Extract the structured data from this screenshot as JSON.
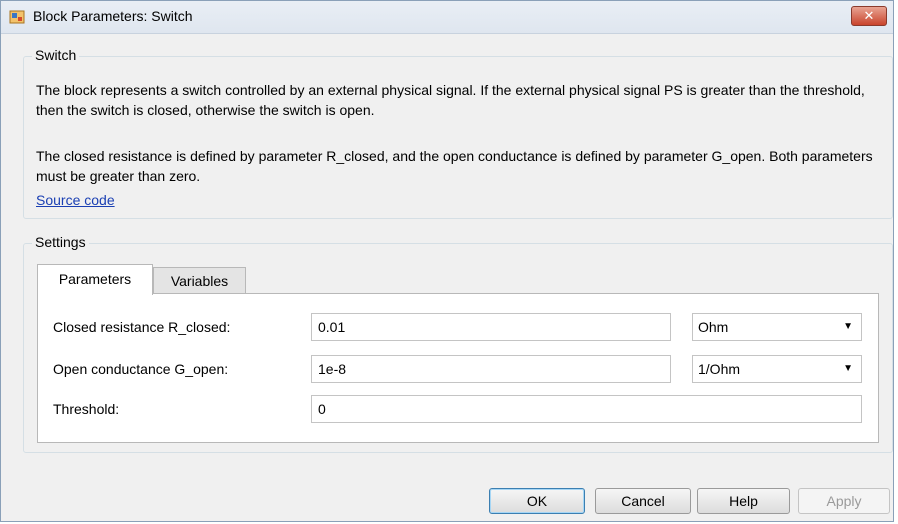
{
  "window": {
    "title": "Block Parameters: Switch",
    "close_label": "✕"
  },
  "block_group": {
    "title": "Switch",
    "description_1": "The block represents a switch controlled by an external physical signal. If the external physical signal PS is greater than the threshold, then the switch is closed, otherwise the switch is open.",
    "description_2": "The closed resistance is defined by parameter R_closed, and the open conductance is defined by parameter G_open. Both parameters must be greater than zero.",
    "link_label": "Source code"
  },
  "settings": {
    "title": "Settings",
    "tabs": [
      {
        "label": "Parameters",
        "active": true
      },
      {
        "label": "Variables",
        "active": false
      }
    ],
    "params": [
      {
        "label": "Closed resistance R_closed:",
        "value": "0.01",
        "unit": "Ohm"
      },
      {
        "label": "Open conductance G_open:",
        "value": "1e-8",
        "unit": "1/Ohm"
      },
      {
        "label": "Threshold:",
        "value": "0"
      }
    ]
  },
  "buttons": {
    "ok": "OK",
    "cancel": "Cancel",
    "help": "Help",
    "apply": "Apply"
  },
  "icons": {
    "app": "simulink-block-icon",
    "dropdown": "chevron-down-icon"
  },
  "colors": {
    "link": "#1a3fb3",
    "close_button": "#c9442c",
    "window_bg": "#f0f0f0"
  }
}
